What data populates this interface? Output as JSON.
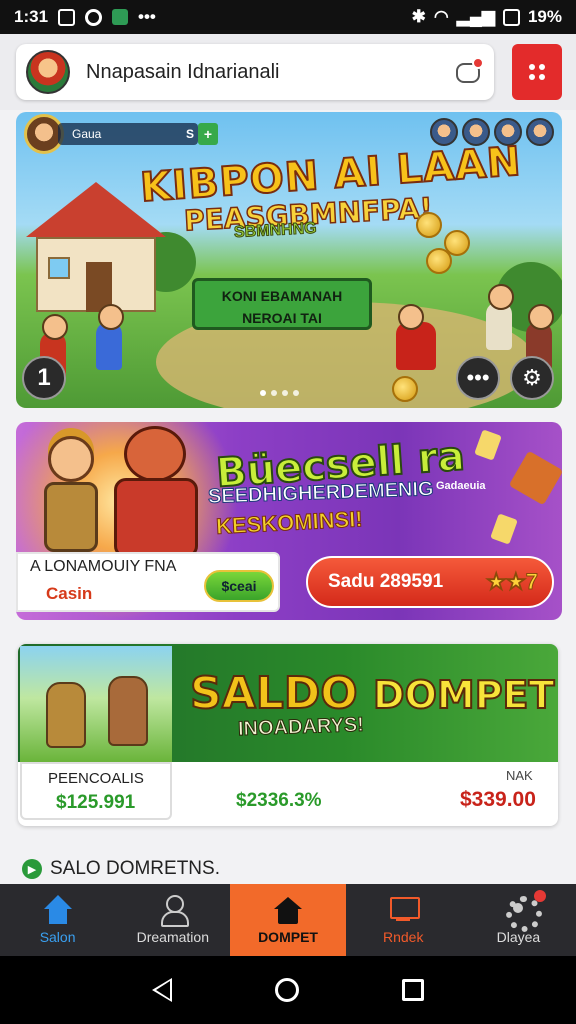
{
  "status_bar": {
    "time": "1:31",
    "battery": "19%"
  },
  "header": {
    "title": "Nnapasain Idnarianali"
  },
  "banner1": {
    "balance_label": "Gaua",
    "balance_currency": "S",
    "title": "KIBPON AI LAAN",
    "subtitle": "PEASGBMNFPA!",
    "subtitle2": "SBMNHNG",
    "sign_line1": "KONI EBAMANAH",
    "sign_line2": "NEROAI TAI",
    "left_button_label": "1",
    "carousel_total": 4,
    "carousel_active": 0
  },
  "banner2": {
    "title": "Büecsell ra",
    "line2": "SEEDHIGHERDEMENIG",
    "line2_small": "Gadaeuia",
    "line3": "KESKOMINSI!",
    "card_line1": "A LONAMOUIY FNA",
    "card_line2": "Casin",
    "card_button": "$ceai",
    "pill_text": "Sadu 289591",
    "pill_stars": "★★7"
  },
  "wallet": {
    "title_a": "SALDO",
    "title_b": "DOMPET",
    "subtitle": "INOADARYS!",
    "left_label": "PEENCOALIS",
    "left_value": "$125.991",
    "mid_value": "$2336.3%",
    "right_label": "NAK",
    "right_value": "$339.00"
  },
  "section": {
    "title": "SALO DOMRETNS."
  },
  "bottom_nav": {
    "items": [
      {
        "label": "Salon",
        "icon": "home-icon"
      },
      {
        "label": "Dreamation",
        "icon": "user-icon"
      },
      {
        "label": "DOMPET",
        "icon": "wallet-icon"
      },
      {
        "label": "Rndek",
        "icon": "store-icon"
      },
      {
        "label": "Dlayea",
        "icon": "gear-icon"
      }
    ]
  },
  "colors": {
    "header_menu": "#e32b2b",
    "nav_active": "#f26a2a",
    "positive": "#2a9a2a",
    "negative": "#c8231a"
  }
}
